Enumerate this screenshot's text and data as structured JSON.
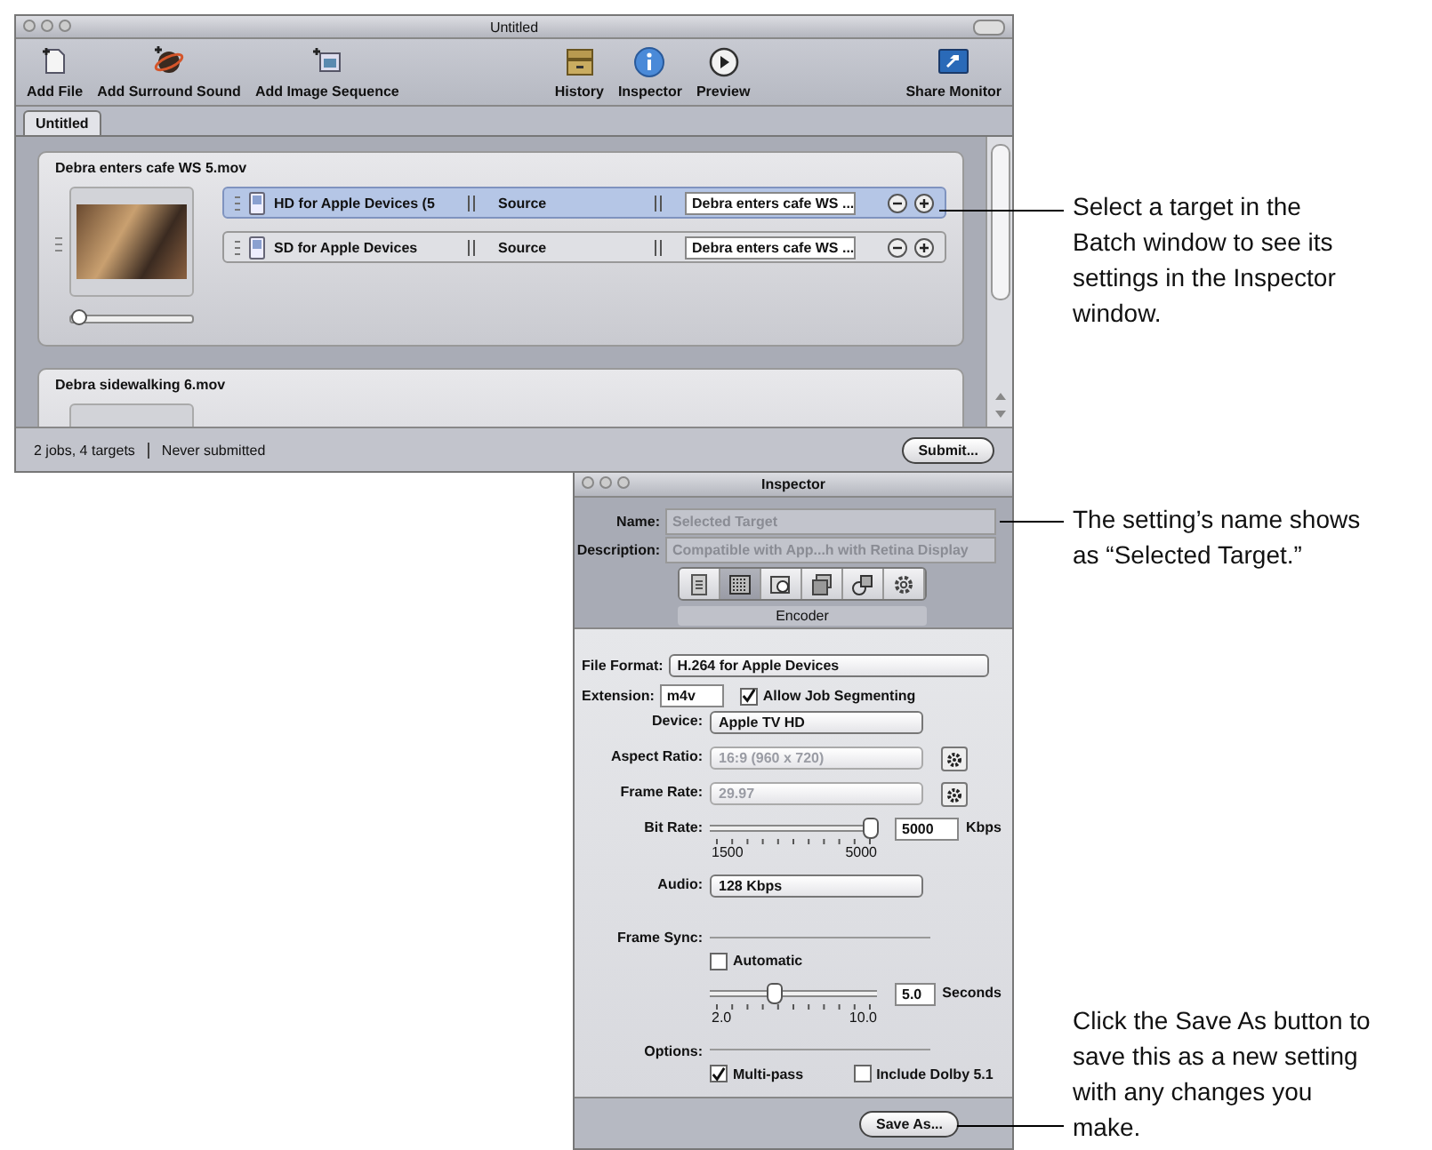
{
  "batch_window": {
    "title": "Untitled",
    "toolbar": [
      {
        "kind": "add-file",
        "label": "Add File"
      },
      {
        "kind": "surround",
        "label": "Add Surround Sound"
      },
      {
        "kind": "image-seq",
        "label": "Add Image Sequence"
      },
      {
        "kind": "spacer"
      },
      {
        "kind": "history",
        "label": "History"
      },
      {
        "kind": "inspector",
        "label": "Inspector"
      },
      {
        "kind": "preview",
        "label": "Preview"
      },
      {
        "kind": "spacer"
      },
      {
        "kind": "monitor",
        "label": "Share Monitor"
      }
    ],
    "tabs": [
      {
        "label": "Untitled",
        "selected": true
      }
    ],
    "jobs": [
      {
        "name": "Debra enters cafe WS 5.mov",
        "level": 0,
        "targets": [
          {
            "setting": "HD for Apple Devices (5",
            "destination": "Source",
            "output": "Debra enters cafe WS ...",
            "selected": true
          },
          {
            "setting": "SD for Apple Devices",
            "destination": "Source",
            "output": "Debra enters cafe WS ...",
            "selected": false
          }
        ]
      },
      {
        "name": "Debra sidewalking 6.mov"
      }
    ],
    "status": [
      "2 jobs, 4 targets",
      "Never submitted"
    ],
    "submit": "Submit..."
  },
  "inspector": {
    "title": "Inspector",
    "name": {
      "label": "Name:",
      "value": "Selected Target"
    },
    "description": {
      "label": "Description:",
      "value": "Compatible with App...h with Retina Display"
    },
    "panes": [
      {
        "kind": "summary",
        "selected": false
      },
      {
        "kind": "encoder",
        "selected": true
      },
      {
        "kind": "frame",
        "selected": false
      },
      {
        "kind": "layers",
        "selected": false
      },
      {
        "kind": "actions",
        "selected": false
      },
      {
        "kind": "gear",
        "selected": false
      }
    ],
    "pane_label": "Encoder",
    "file_format": {
      "label": "File Format:",
      "value": "H.264 for Apple Devices"
    },
    "extension": {
      "label": "Extension:",
      "value": "m4v"
    },
    "segmenting": {
      "label": "Allow Job Segmenting",
      "checked": true
    },
    "rows": [
      {
        "kind": "popup",
        "label": "Device:",
        "value": "Apple TV HD",
        "disabled": false,
        "gear": false
      },
      {
        "kind": "popup",
        "label": "Aspect Ratio:",
        "value": "16:9  (960 x 720)",
        "disabled": true,
        "gear": true
      },
      {
        "kind": "popup",
        "label": "Frame Rate:",
        "value": "29.97",
        "disabled": true,
        "gear": true
      },
      {
        "kind": "slider",
        "label": "Bit Rate:",
        "level": 1,
        "value": "5000",
        "unit": "Kbps",
        "min": "1500",
        "max": "5000"
      },
      {
        "kind": "popup",
        "label": "Audio:",
        "value": "128 Kbps",
        "disabled": false,
        "gear": false
      },
      {
        "kind": "section",
        "label": "Frame Sync:"
      },
      {
        "kind": "check",
        "label": "Automatic",
        "checked": false
      },
      {
        "kind": "slider",
        "level": 0.375,
        "value": "5.0",
        "unit": "Seconds",
        "min": "2.0",
        "max": "10.0"
      },
      {
        "kind": "section",
        "label": "Options:"
      },
      {
        "kind": "checks",
        "items": [
          {
            "label": "Multi-pass",
            "checked": true
          },
          {
            "label": "Include Dolby 5.1",
            "checked": false
          }
        ]
      }
    ],
    "save_button": "Save As..."
  },
  "callouts": [
    {
      "text": "Select a target in the Batch window to see its settings in the Inspector window."
    },
    {
      "text": "The setting’s name shows as “Selected Target.”"
    },
    {
      "text": "Click the Save As button to save this as a new setting with any changes you make."
    }
  ]
}
